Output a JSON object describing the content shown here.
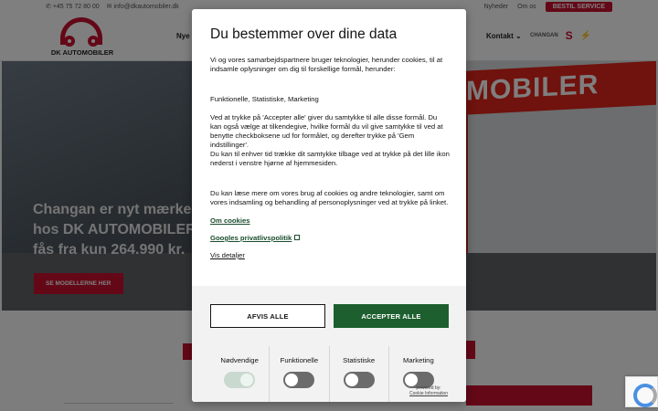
{
  "site": {
    "phone": "+45 75 72 80 00",
    "email": "info@dkautomobiler.dk",
    "top_links": [
      "Nyheder",
      "Om os"
    ],
    "service_button": "BESTIL SERVICE",
    "logo_text": "DK AUTOMOBILER",
    "nav_left_partial": "Nye b",
    "nav_contact": "Kontakt",
    "brands": [
      "CHANGAN",
      "SUZUKI",
      "OPEL"
    ],
    "hero_sign": "MOBILER",
    "hero_title": "Changan er nyt mærke hos DK AUTOMOBILER - fås fra kun 264.990 kr.",
    "hero_button": "SE MODELLERNE HER",
    "colors": {
      "brand_red": "#c8102e",
      "accept_green": "#1d5f2f"
    }
  },
  "cookie": {
    "title": "Du bestemmer over dine data",
    "intro": "Vi og vores samarbejdspartnere bruger teknologier, herunder cookies, til at indsamle oplysninger om dig til forskellige formål, herunder:",
    "purposes": "Funktionelle, Statistiske, Marketing",
    "para_accept": "Ved at trykke på 'Accepter alle' giver du samtykke til alle disse formål. Du kan også vælge at tilkendegive, hvilke formål du vil give samtykke til ved at benytte checkboksene ud for formålet, og derefter trykke på 'Gem indstillinger'.",
    "para_withdraw": "Du kan til enhver tid trække dit samtykke tilbage ved at trykke på det lille ikon nederst i venstre hjørne af hjemmesiden.",
    "para_more": "Du kan læse mere om vores brug af cookies og andre teknologier, samt om vores indsamling og behandling af personoplysninger ved at trykke på linket.",
    "link_about": "Om cookies",
    "link_google": "Googles privatlivspolitik",
    "link_details": "Vis detaljer",
    "reject_label": "AFVIS ALLE",
    "accept_label": "ACCEPTER ALLE",
    "toggles": [
      {
        "label": "Nødvendige",
        "on": true
      },
      {
        "label": "Funktionelle",
        "on": false
      },
      {
        "label": "Statistiske",
        "on": false
      },
      {
        "label": "Marketing",
        "on": false
      }
    ],
    "powered_by": "powered by:",
    "powered_brand": "Cookie Information"
  }
}
